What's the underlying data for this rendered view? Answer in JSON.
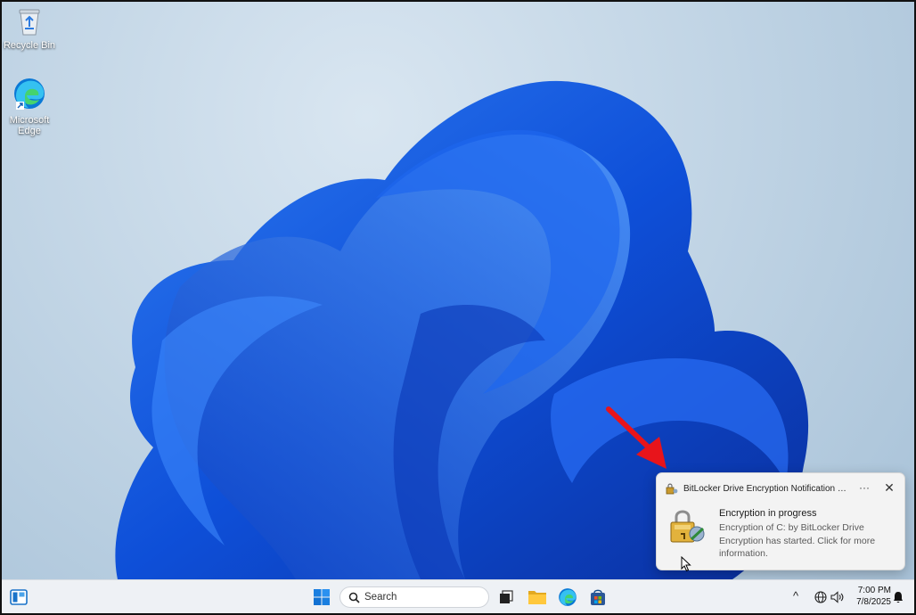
{
  "desktop": {
    "icons": [
      {
        "label": "Recycle Bin"
      },
      {
        "label": "Microsoft Edge"
      }
    ]
  },
  "notification": {
    "app_name": "BitLocker Drive Encryption Notification Ut...",
    "more_label": "···",
    "close_label": "✕",
    "title": "Encryption in progress",
    "body": "Encryption of C: by BitLocker Drive Encryption has started. Click for more information."
  },
  "taskbar": {
    "search_placeholder": "Search",
    "tray_chevron": "^",
    "time": "7:00 PM",
    "date": "7/8/2025"
  },
  "colors": {
    "accent": "#0067c0",
    "annotation_arrow": "#e8141b"
  }
}
